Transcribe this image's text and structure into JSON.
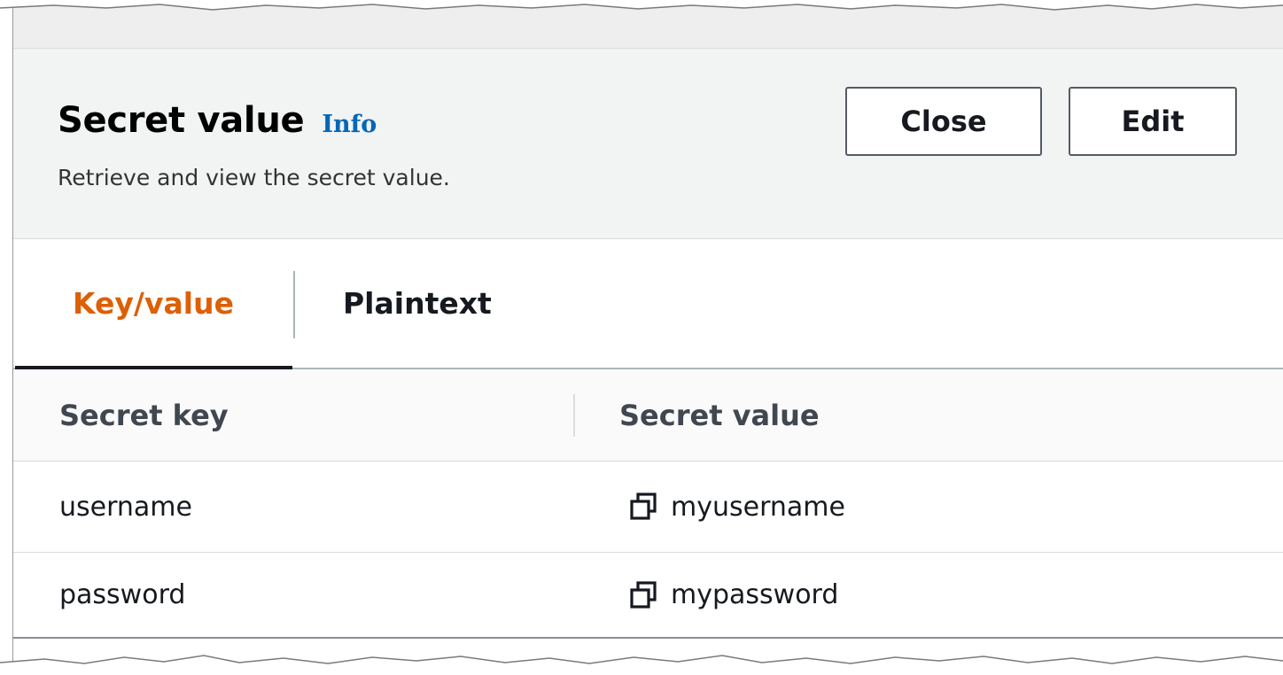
{
  "header": {
    "title": "Secret value",
    "info_label": "Info",
    "subtitle": "Retrieve and view the secret value.",
    "close_label": "Close",
    "edit_label": "Edit"
  },
  "tabs": [
    {
      "label": "Key/value",
      "active": true
    },
    {
      "label": "Plaintext",
      "active": false
    }
  ],
  "table": {
    "columns": [
      "Secret key",
      "Secret value"
    ],
    "rows": [
      {
        "key": "username",
        "value": "myusername"
      },
      {
        "key": "password",
        "value": "mypassword"
      }
    ]
  },
  "colors": {
    "active_tab": "#dd5f06",
    "info_link": "#0067b8",
    "header_bg": "#f2f3f3"
  },
  "icons": {
    "copy": "copy-icon"
  }
}
